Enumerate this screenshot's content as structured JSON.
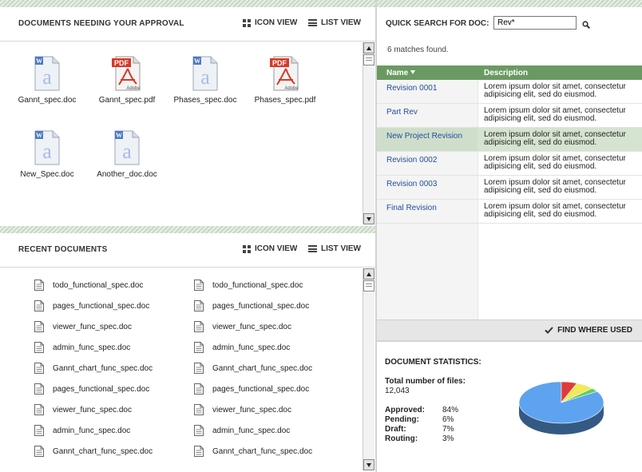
{
  "approval": {
    "title": "Documents needing your approval",
    "icon_view": "ICON VIEW",
    "list_view": "LIST VIEW",
    "docs": [
      {
        "name": "Gannt_spec.doc",
        "type": "doc"
      },
      {
        "name": "Gannt_spec.pdf",
        "type": "pdf"
      },
      {
        "name": "Phases_spec.doc",
        "type": "doc"
      },
      {
        "name": "Phases_spec.pdf",
        "type": "pdf"
      },
      {
        "name": "New_Spec.doc",
        "type": "doc"
      },
      {
        "name": "Another_doc.doc",
        "type": "doc"
      }
    ],
    "pdf_badge": "PDF",
    "adobe_label": "Adobe"
  },
  "recent": {
    "title": "Recent documents",
    "icon_view": "ICON VIEW",
    "list_view": "LIST VIEW",
    "left": [
      "todo_functional_spec.doc",
      "pages_functional_spec.doc",
      "viewer_func_spec.doc",
      "admin_func_spec.doc",
      "Gannt_chart_func_spec.doc",
      "pages_functional_spec.doc",
      "viewer_func_spec.doc",
      "admin_func_spec.doc",
      "Gannt_chart_func_spec.doc"
    ],
    "right": [
      "todo_functional_spec.doc",
      "pages_functional_spec.doc",
      "viewer_func_spec.doc",
      "admin_func_spec.doc",
      "Gannt_chart_func_spec.doc",
      "pages_functional_spec.doc",
      "viewer_func_spec.doc",
      "admin_func_spec.doc",
      "Gannt_chart_func_spec.doc"
    ]
  },
  "search": {
    "label": "QUICK SEARCH FOR DOC:",
    "value": "Rev*",
    "matches": "6 matches found.",
    "col_name": "Name",
    "col_desc": "Description",
    "selected_index": 2,
    "rows": [
      {
        "name": "Revision 0001",
        "desc": "Lorem ipsum dolor sit amet, consectetur adipisicing elit, sed do eiusmod."
      },
      {
        "name": "Part Rev",
        "desc": "Lorem ipsum dolor sit amet, consectetur adipisicing elit, sed do eiusmod."
      },
      {
        "name": "New Project Revision",
        "desc": "Lorem ipsum dolor sit amet, consectetur adipisicing elit, sed do eiusmod."
      },
      {
        "name": "Revision 0002",
        "desc": "Lorem ipsum dolor sit amet, consectetur adipisicing elit, sed do eiusmod."
      },
      {
        "name": "Revision 0003",
        "desc": "Lorem ipsum dolor sit amet, consectetur adipisicing elit, sed do eiusmod."
      },
      {
        "name": "Final Revision",
        "desc": "Lorem ipsum dolor sit amet, consectetur adipisicing elit, sed do eiusmod."
      }
    ],
    "find_where_used": "FIND WHERE USED"
  },
  "stats": {
    "title": "DOCUMENT STATISTICS:",
    "total_label": "Total number of files:",
    "total_value": "12,043",
    "items": [
      {
        "label": "Approved:",
        "value": "84%",
        "pct": 84,
        "color": "#5ea3f0"
      },
      {
        "label": "Pending:",
        "value": "6%",
        "pct": 6,
        "color": "#e03a3a"
      },
      {
        "label": "Draft:",
        "value": "7%",
        "pct": 7,
        "color": "#f2e85a"
      },
      {
        "label": "Routing:",
        "value": "3%",
        "pct": 3,
        "color": "#5fcf5f"
      }
    ]
  },
  "colors": {
    "table_header": "#6a9a62",
    "selected_row": "#d5e3d1",
    "link": "#1f4e9c"
  }
}
